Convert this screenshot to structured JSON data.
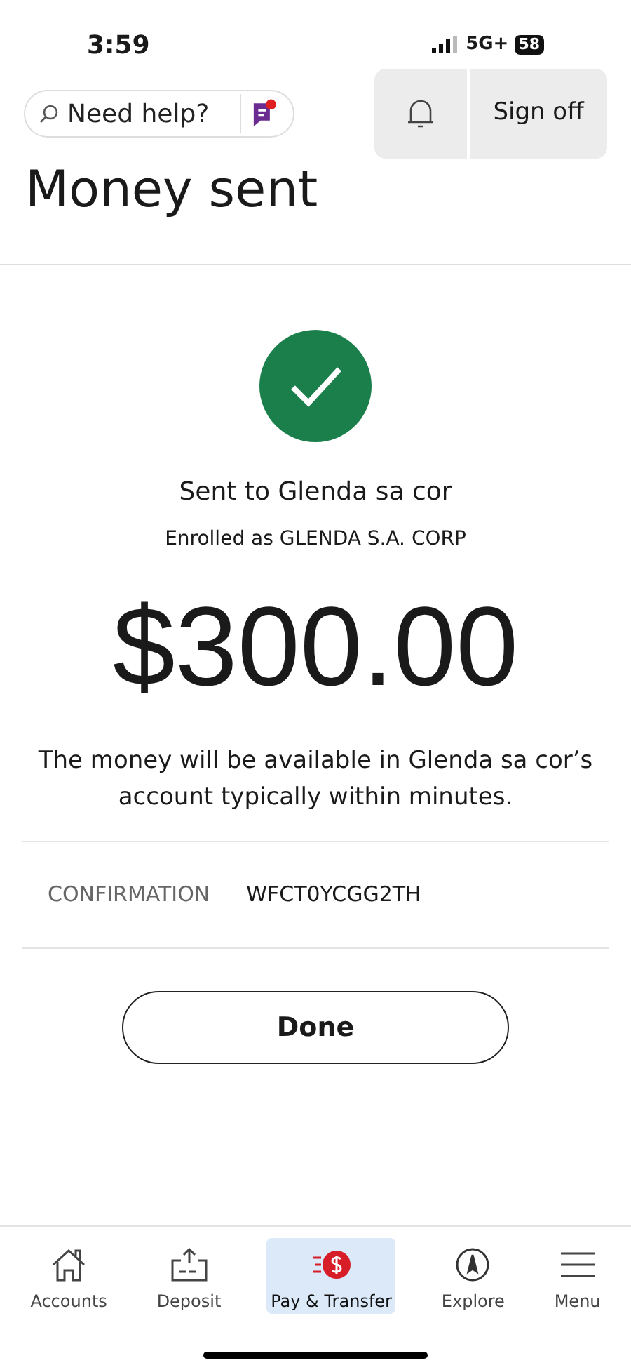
{
  "status_bar": {
    "time": "3:59",
    "network": "5G+",
    "battery": "58"
  },
  "header": {
    "search": {
      "placeholder": "Need help?"
    },
    "sign_off": "Sign off"
  },
  "title": "Money sent",
  "result": {
    "recipient": "Sent to Glenda sa cor",
    "enrolled": "Enrolled as GLENDA S.A. CORP",
    "amount": "$300.00",
    "message": "The money will be available in Glenda sa cor’s account typically within minutes."
  },
  "confirmation": {
    "label": "CONFIRMATION",
    "value": "WFCT0YCGG2TH"
  },
  "done_button": "Done",
  "nav": [
    {
      "kind": "home",
      "label": "Accounts",
      "selected": false
    },
    {
      "kind": "deposit",
      "label": "Deposit",
      "selected": false
    },
    {
      "kind": "pay",
      "label": "Pay & Transfer",
      "selected": true
    },
    {
      "kind": "explore",
      "label": "Explore",
      "selected": false
    },
    {
      "kind": "menu",
      "label": "Menu",
      "selected": false
    }
  ]
}
